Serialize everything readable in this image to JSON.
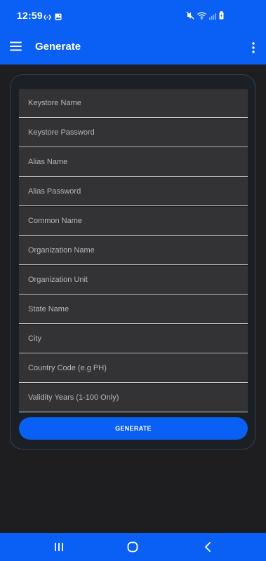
{
  "status_bar": {
    "time": "12:59",
    "left_icons": [
      "link-icon",
      "image-icon"
    ],
    "right_icons": [
      "mute-icon",
      "wifi-icon",
      "signal-icon",
      "battery-icon"
    ]
  },
  "app_bar": {
    "title": "Generate",
    "menu_icon": "hamburger-menu-icon",
    "more_icon": "more-vertical-icon"
  },
  "form": {
    "fields": [
      {
        "placeholder": "Keystore Name"
      },
      {
        "placeholder": "Keystore Password"
      },
      {
        "placeholder": "Alias Name"
      },
      {
        "placeholder": "Alias Password"
      },
      {
        "placeholder": "Common Name"
      },
      {
        "placeholder": "Organization Name"
      },
      {
        "placeholder": "Organization Unit"
      },
      {
        "placeholder": "State Name"
      },
      {
        "placeholder": "City"
      },
      {
        "placeholder": "Country Code (e.g PH)"
      },
      {
        "placeholder": "Validity Years (1-100 Only)"
      }
    ],
    "generate_label": "GENERATE"
  },
  "nav_bar": {
    "icons": [
      "recents-icon",
      "home-icon",
      "back-icon"
    ]
  },
  "colors": {
    "accent": "#0a60f5",
    "background": "#1e1e20",
    "card": "#1b1f26",
    "field": "#333336"
  }
}
